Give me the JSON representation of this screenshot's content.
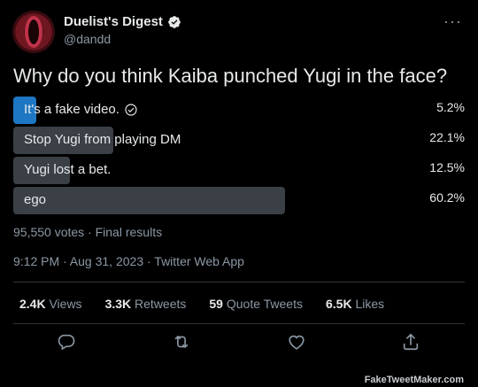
{
  "tweet": {
    "display_name": "Duelist's Digest",
    "handle": "@dandd",
    "question": "Why do you think Kaiba punched Yugi in the face?"
  },
  "poll": {
    "options": [
      {
        "label": "It's a fake video.",
        "percent_text": "5.2%",
        "percent": 5.2,
        "chosen": true
      },
      {
        "label": "Stop Yugi from playing DM",
        "percent_text": "22.1%",
        "percent": 22.1,
        "chosen": false
      },
      {
        "label": "Yugi lost a bet.",
        "percent_text": "12.5%",
        "percent": 12.5,
        "chosen": false
      },
      {
        "label": "ego",
        "percent_text": "60.2%",
        "percent": 60.2,
        "chosen": false
      }
    ],
    "votes_line": "95,550 votes · Final results"
  },
  "timestamp": "9:12 PM · Aug 31, 2023 · Twitter Web App",
  "stats": {
    "views_count": "2.4K",
    "views_label": "Views",
    "retweets_count": "3.3K",
    "retweets_label": "Retweets",
    "quotes_count": "59",
    "quotes_label": "Quote Tweets",
    "likes_count": "6.5K",
    "likes_label": "Likes"
  },
  "icons": {
    "reply": "reply-icon",
    "retweet": "retweet-icon",
    "like": "heart-icon",
    "share": "share-icon",
    "more": "more-icon",
    "verified": "verified-badge-icon",
    "checkmark": "check-circle-icon"
  },
  "colors": {
    "background": "#000000",
    "chosen_bar": "#1d77c2",
    "bar": "#3a4046",
    "muted_text": "#8b98a5"
  },
  "watermark": "FakeTweetMaker.com"
}
